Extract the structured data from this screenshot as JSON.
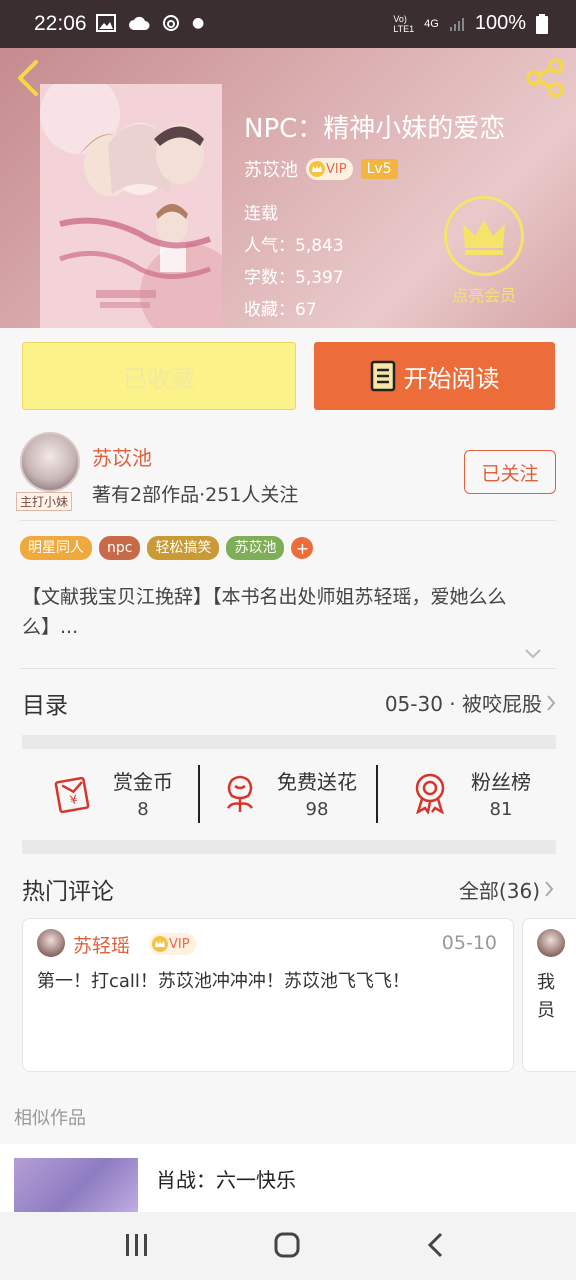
{
  "status_bar": {
    "time": "22:06",
    "network_top": "Vo)",
    "network_bottom": "LTE1",
    "net_type": "4G",
    "battery": "100%"
  },
  "book": {
    "title": "NPC：精神小妹的爱恋",
    "author": "苏苡池",
    "vip": "VIP",
    "level": "Lv5",
    "status": "连载",
    "popularity": "人气：5,843",
    "word_count": "字数：5,397",
    "favorites": "收藏：67",
    "member_label": "点亮会员"
  },
  "actions": {
    "collected": "已收藏",
    "start_reading": "开始阅读"
  },
  "author_card": {
    "name": "苏苡池",
    "stats": "著有2部作品·251人关注",
    "avatar_tag": "主打小妹",
    "follow": "已关注"
  },
  "tags": [
    {
      "label": "明星同人",
      "color": "#f0a93c"
    },
    {
      "label": "npc",
      "color": "#c66a4a"
    },
    {
      "label": "轻松搞笑",
      "color": "#c99a35"
    },
    {
      "label": "苏苡池",
      "color": "#7fae58"
    }
  ],
  "tag_more": "+",
  "description": "【文献我宝贝江挽辞】【本书名出处师姐苏轻瑶，爱她么么么】...",
  "toc": {
    "label": "目录",
    "latest": "05-30 · 被咬屁股"
  },
  "stats": [
    {
      "label": "赏金币",
      "value": "8"
    },
    {
      "label": "免费送花",
      "value": "98"
    },
    {
      "label": "粉丝榜",
      "value": "81"
    }
  ],
  "comments": {
    "title": "热门评论",
    "all": "全部(36)",
    "items": [
      {
        "user": "苏轻瑶",
        "vip": "VIP",
        "date": "05-10",
        "text": "第一！打call！苏苡池冲冲冲！苏苡池飞飞飞！"
      }
    ],
    "peek_text_1": "我",
    "peek_text_2": "员"
  },
  "similar": {
    "label": "相似作品",
    "items": [
      {
        "title": "肖战：六一快乐"
      }
    ]
  },
  "colors": {
    "accent": "#ec6d3a",
    "author_red": "#e0603e",
    "collected_yellow": "#fbf38a",
    "member_gold": "#f5e36a"
  }
}
